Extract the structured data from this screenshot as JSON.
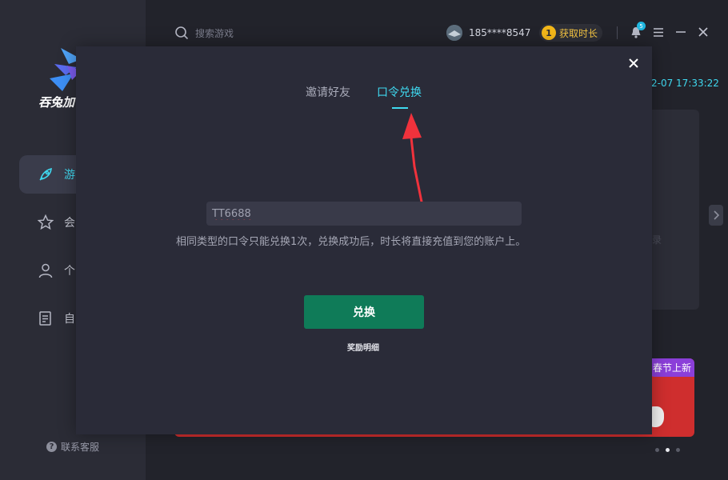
{
  "sidebar": {
    "logo_text": "吞兔加",
    "items": [
      {
        "label": "游",
        "icon": "rocket-icon",
        "active": true
      },
      {
        "label": "会",
        "icon": "star-icon",
        "active": false
      },
      {
        "label": "个",
        "icon": "person-icon",
        "active": false
      },
      {
        "label": "自",
        "icon": "document-icon",
        "active": false
      }
    ],
    "support_label": "联系客服",
    "support_icon": "question-icon"
  },
  "header": {
    "search_placeholder": "搜索游戏",
    "username": "185****8547",
    "get_time_label": "获取时长",
    "coin_digit": "1",
    "notification_count": "5"
  },
  "main": {
    "datetime": "2-07 17:33:22",
    "card_faint_text": "录",
    "banner_tag": "春节上新",
    "carousel": {
      "count": 3,
      "active_index": 1
    }
  },
  "modal": {
    "tabs": [
      {
        "label": "邀请好友",
        "active": false
      },
      {
        "label": "口令兑换",
        "active": true
      }
    ],
    "code_value": "TT6688",
    "hint": "相同类型的口令只能兑换1次，兑换成功后，时长将直接充值到您的账户上。",
    "redeem_label": "兑换",
    "reward_details_label": "奖励明细"
  },
  "colors": {
    "accent": "#3fd9f0",
    "redeem_button": "#0f7b58",
    "annotation_arrow": "#f0323c",
    "modal_bg": "#2a2b38"
  }
}
